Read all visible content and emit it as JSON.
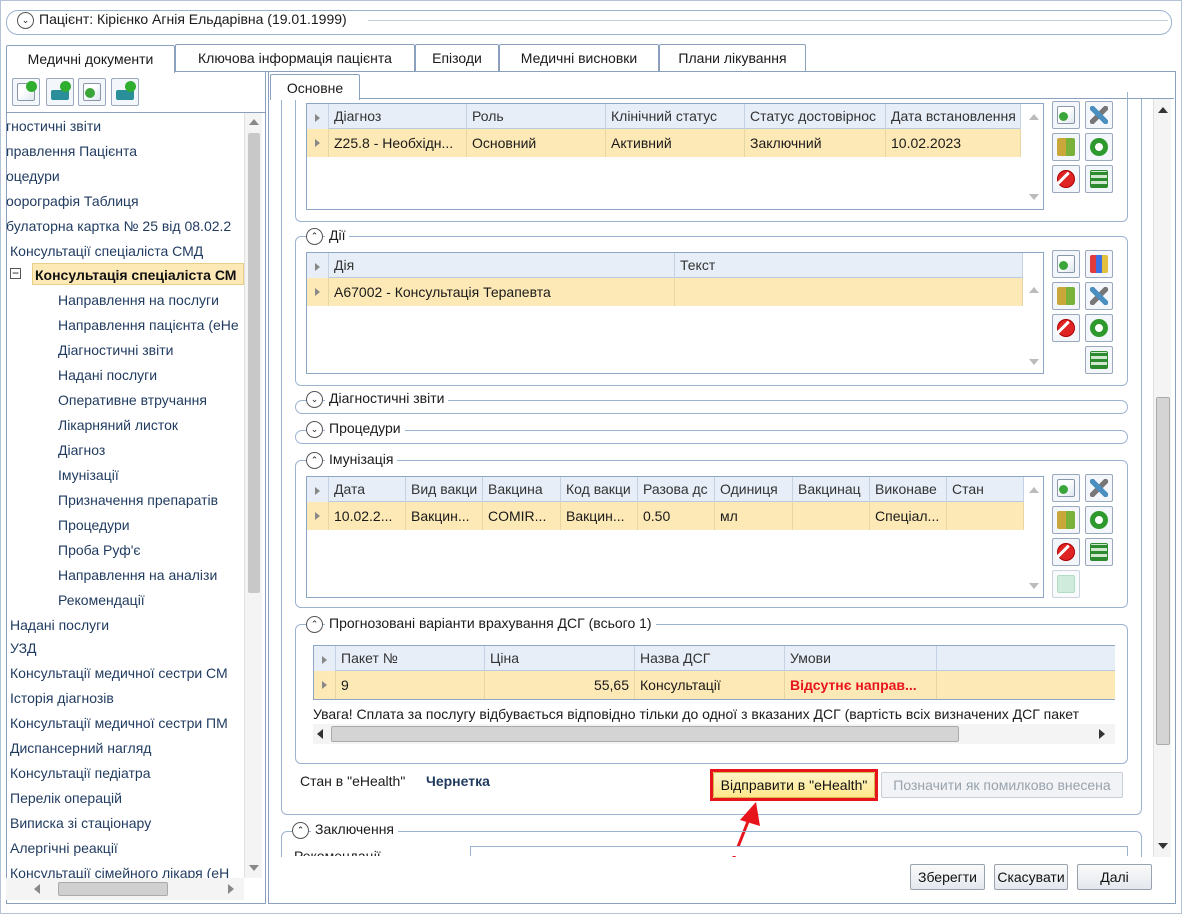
{
  "patient": {
    "title": "Пацієнт: Кірієнко Агнія Ельдарівна (19.01.1999)"
  },
  "tabs": [
    {
      "label": "Медичні документи"
    },
    {
      "label": "Ключова інформація пацієнта"
    },
    {
      "label": "Епізоди"
    },
    {
      "label": "Медичні висновки"
    },
    {
      "label": "Плани лікування"
    }
  ],
  "subtab": {
    "label": "Основне"
  },
  "tree": {
    "items": [
      {
        "label": "гностичні звіти"
      },
      {
        "label": "правлення Пацієнта"
      },
      {
        "label": "оцедури"
      },
      {
        "label": "оорографія Таблиця"
      },
      {
        "label": "булаторна картка № 25 від 08.02.2"
      },
      {
        "label": "Консультації спеціаліста СМД"
      },
      {
        "label": "Консультація спеціаліста СМ"
      },
      {
        "label": "Направлення на послуги"
      },
      {
        "label": "Направлення пацієнта (eHe"
      },
      {
        "label": "Діагностичні звіти"
      },
      {
        "label": "Надані послуги"
      },
      {
        "label": "Оперативне втручання"
      },
      {
        "label": "Лікарняний листок"
      },
      {
        "label": "Діагноз"
      },
      {
        "label": "Імунізації"
      },
      {
        "label": "Призначення препаратів"
      },
      {
        "label": "Процедури"
      },
      {
        "label": "Проба Руф'є"
      },
      {
        "label": "Направлення на аналізи"
      },
      {
        "label": "Рекомендації"
      },
      {
        "label": "Надані послуги"
      },
      {
        "label": "УЗД"
      },
      {
        "label": "Консультації медичної сестри СМ"
      },
      {
        "label": "Історія діагнозів"
      },
      {
        "label": "Консультації медичної сестри ПМ"
      },
      {
        "label": "Диспансерний нагляд"
      },
      {
        "label": "Консультації педіатра"
      },
      {
        "label": "Перелік операцій"
      },
      {
        "label": "Виписка зі стаціонару"
      },
      {
        "label": "Алергічні реакції"
      },
      {
        "label": "Консультації сімейного лікаря (eH"
      }
    ]
  },
  "diagnosis_grid": {
    "headers": [
      "Діагноз",
      "Роль",
      "Клінічний статус",
      "Статус достовірнос",
      "Дата встановлення"
    ],
    "row": [
      "Z25.8 - Необхідн...",
      "Основний",
      "Активний",
      "Заключний",
      "10.02.2023"
    ]
  },
  "actions": {
    "title": "Дії",
    "headers": [
      "Дія",
      "Текст"
    ],
    "row": [
      "A67002 - Консультація Терапевта",
      ""
    ]
  },
  "diag_reports": {
    "title": "Діагностичні звіти"
  },
  "procedures": {
    "title": "Процедури"
  },
  "immunization": {
    "title": "Імунізація",
    "headers": [
      "Дата",
      "Вид вакци",
      "Вакцина",
      "Код вакци",
      "Разова дс",
      "Одиниця",
      "Вакцинац",
      "Виконаве",
      "Стан"
    ],
    "row": [
      "10.02.2...",
      "Вакцин...",
      "COMIR...",
      "Вакцин...",
      "0.50",
      "мл",
      "",
      "Спеціал...",
      ""
    ]
  },
  "dsg": {
    "title": "Прогнозовані варіанти врахування ДСГ (всього 1)",
    "headers": [
      "Пакет №",
      "Ціна",
      "Назва ДСГ",
      "Умови"
    ],
    "row": [
      "9",
      "55,65",
      "Консультації",
      "Відсутнє направ..."
    ],
    "warning": "Увага! Сплата за послугу відбувається відповідно тільки до одної з вказаних ДСГ (вартість всіх визначених ДСГ пакет"
  },
  "ehealth": {
    "status_label": "Стан в \"eHealth\"",
    "status_value": "Чернетка",
    "send_button": "Відправити в \"eHealth\"",
    "mark_button": "Позначити як помилково внесена"
  },
  "conclusion": {
    "title": "Заключення",
    "recommendations_label": "Рекомендації"
  },
  "footer": {
    "save": "Зберегти",
    "cancel": "Скасувати",
    "next": "Далі"
  },
  "colors": {
    "highlight_row": "#fde9b6",
    "annotation": "#e8141c",
    "header_bg": "#e7eef8"
  }
}
